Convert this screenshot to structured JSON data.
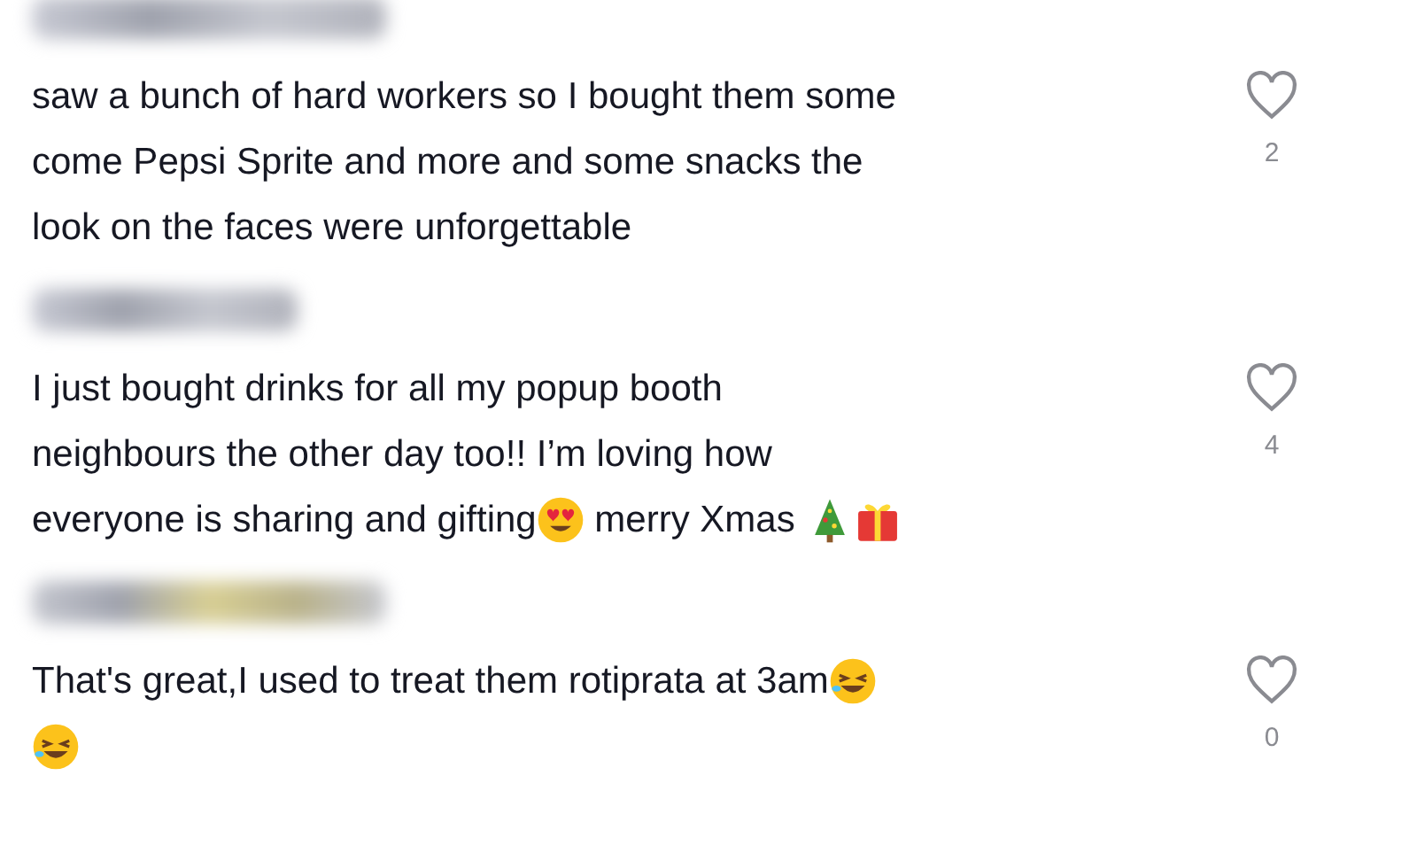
{
  "comments": [
    {
      "lines": [
        [
          {
            "kind": "text",
            "text": "saw a bunch of hard workers so I bought them some"
          }
        ],
        [
          {
            "kind": "text",
            "text": "come Pepsi Sprite and more and some snacks the"
          }
        ],
        [
          {
            "kind": "text",
            "text": "look on the faces were unforgettable"
          }
        ]
      ],
      "liked": false,
      "likes": "2"
    },
    {
      "lines": [
        [
          {
            "kind": "text",
            "text": "I just bought drinks for all my popup booth"
          }
        ],
        [
          {
            "kind": "text",
            "text": "neighbours the other day too!! I’m loving how"
          }
        ],
        [
          {
            "kind": "text",
            "text": "everyone is sharing and gifting"
          },
          {
            "kind": "heart-eyes"
          },
          {
            "kind": "text",
            "text": " merry Xmas "
          },
          {
            "kind": "tree"
          },
          {
            "kind": "gift"
          }
        ]
      ],
      "liked": false,
      "likes": "4"
    },
    {
      "lines": [
        [
          {
            "kind": "text",
            "text": "That's great,I used to treat them rotiprata at 3am"
          },
          {
            "kind": "laughing"
          }
        ],
        [
          {
            "kind": "laughing"
          }
        ]
      ],
      "liked": false,
      "likes": "0"
    }
  ]
}
